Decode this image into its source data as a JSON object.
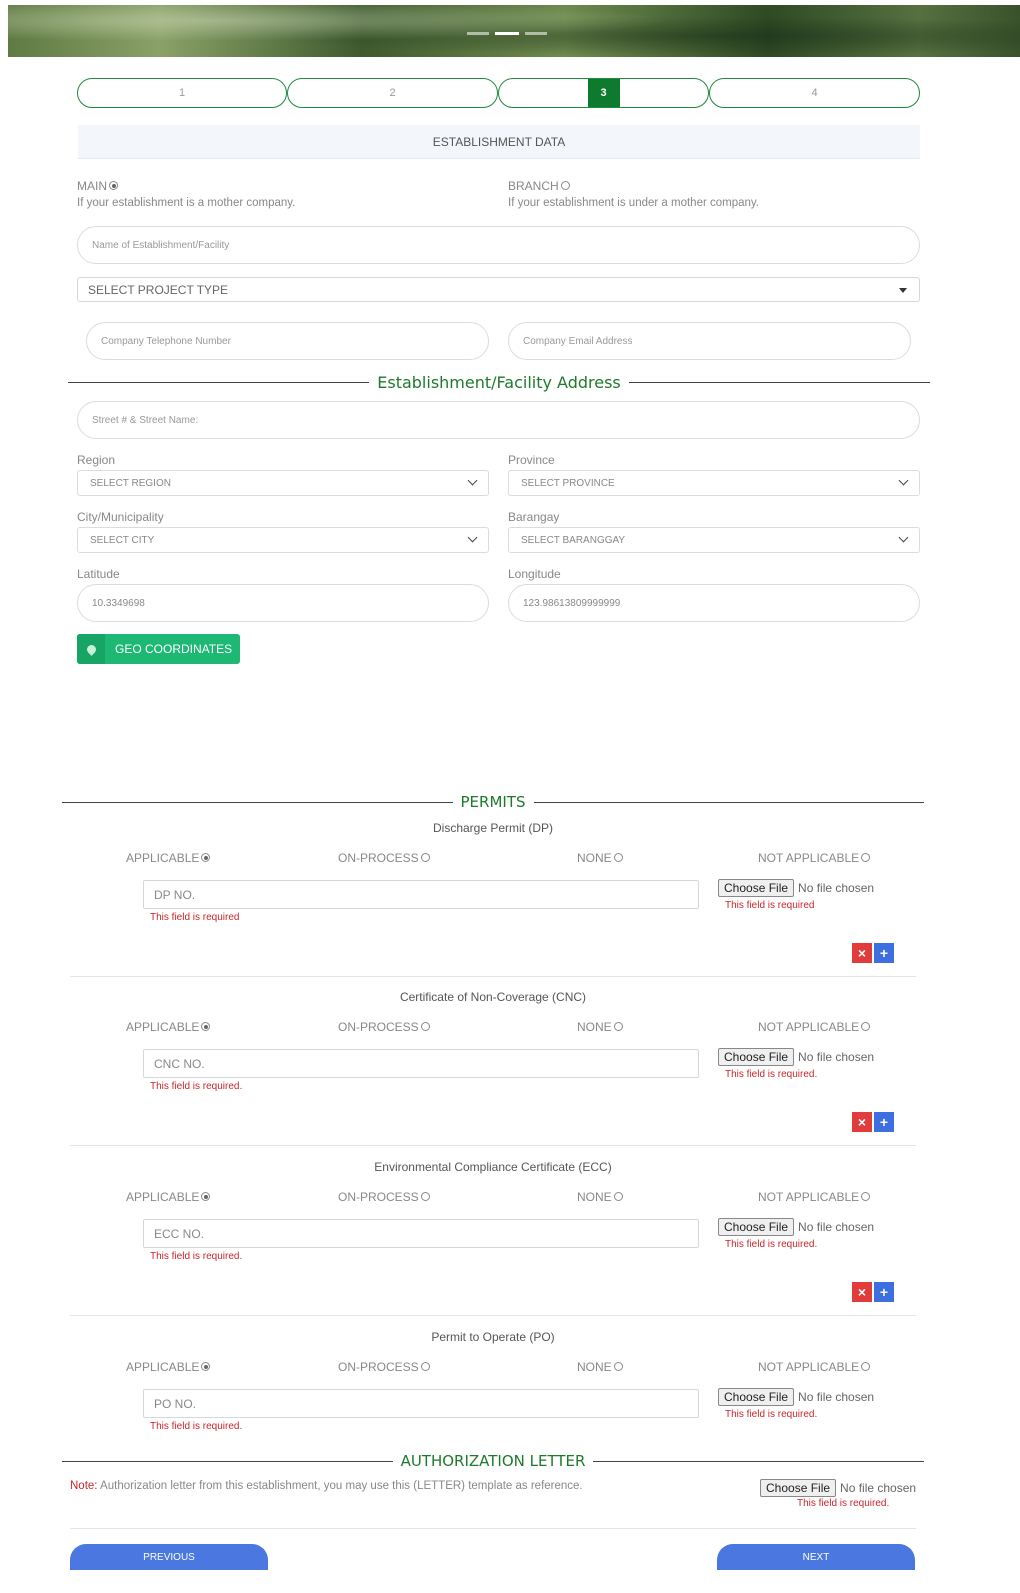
{
  "steps": [
    "1",
    "2",
    "3",
    "4"
  ],
  "section_header": "ESTABLISHMENT DATA",
  "establishment_type": {
    "main": {
      "label": "MAIN",
      "desc": "If your establishment is a mother company."
    },
    "branch": {
      "label": "BRANCH",
      "desc": "If your establishment is under a mother company."
    }
  },
  "fields": {
    "name_placeholder": "Name of Establishment/Facility",
    "project_type": "SELECT PROJECT TYPE",
    "telephone_placeholder": "Company Telephone Number",
    "email_placeholder": "Company Email Address"
  },
  "address": {
    "title": "Establishment/Facility Address",
    "street_placeholder": "Street # & Street Name:",
    "region_label": "Region",
    "region_value": "SELECT REGION",
    "province_label": "Province",
    "province_value": "SELECT PROVINCE",
    "city_label": "City/Municipality",
    "city_value": "SELECT CITY",
    "barangay_label": "Barangay",
    "barangay_value": "SELECT BARANGGAY",
    "latitude_label": "Latitude",
    "latitude_value": "10.3349698",
    "longitude_label": "Longitude",
    "longitude_value": "123.98613809999999",
    "geo_button": "GEO COORDINATES"
  },
  "permits": {
    "title": "PERMITS",
    "options": {
      "applicable": "APPLICABLE",
      "on_process": "ON-PROCESS",
      "none": "NONE",
      "not_applicable": "NOT APPLICABLE"
    },
    "choose_file": "Choose File",
    "no_file": "No file chosen",
    "items": [
      {
        "title": "Discharge Permit (DP)",
        "placeholder": "DP NO.",
        "error": "This field is required",
        "file_error": "This field is required"
      },
      {
        "title": "Certificate of Non-Coverage (CNC)",
        "placeholder": "CNC NO.",
        "error": "This field is required.",
        "file_error": "This field is required."
      },
      {
        "title": "Environmental Compliance Certificate (ECC)",
        "placeholder": "ECC NO.",
        "error": "This field is required.",
        "file_error": "This field is required."
      },
      {
        "title": "Permit to Operate (PO)",
        "placeholder": "PO NO.",
        "error": "This field is required.",
        "file_error": "This field is required."
      }
    ]
  },
  "authorization": {
    "title": "AUTHORIZATION LETTER",
    "note_label": "Note:",
    "note_text": " Authorization letter from this establishment, you may use this (LETTER) template as reference.",
    "file_error": "This field is required."
  },
  "nav": {
    "previous": "PREVIOUS",
    "next": "NEXT"
  },
  "colors": {
    "green": "#1e8a3e",
    "blue": "#4a78e0",
    "error": "#c8262c"
  }
}
